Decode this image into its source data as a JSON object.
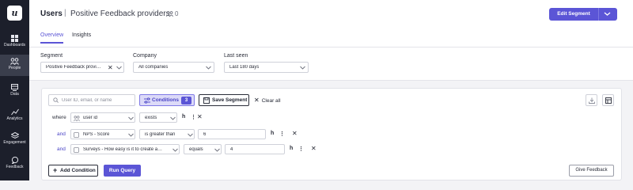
{
  "app": {
    "logo": "u"
  },
  "sidebar": {
    "items": [
      {
        "label": "Dashboards",
        "icon": "grid-icon"
      },
      {
        "label": "People",
        "icon": "people-icon",
        "active": true
      },
      {
        "label": "Data",
        "icon": "database-icon"
      },
      {
        "label": "Analytics",
        "icon": "chart-line-icon"
      },
      {
        "label": "Engagement",
        "icon": "layers-icon"
      },
      {
        "label": "Feedback",
        "icon": "chat-bubble-icon"
      }
    ]
  },
  "header": {
    "title": "Users",
    "separator": "|",
    "subtitle": "Positive Feedback providers",
    "user_count": "0",
    "edit_segment_label": "Edit Segment",
    "tabs": [
      {
        "label": "Overview",
        "active": true
      },
      {
        "label": "Insights",
        "active": false
      }
    ]
  },
  "filters": {
    "segment": {
      "label": "Segment",
      "value": "Positive Feedback provi…"
    },
    "company": {
      "label": "Company",
      "value": "All companies"
    },
    "last_seen": {
      "label": "Last seen",
      "value": "Last 180 days"
    }
  },
  "query": {
    "search_placeholder": "User ID, email, or name",
    "conditions_label": "Conditions",
    "conditions_count": "3",
    "save_segment_label": "Save Segment",
    "clear_all_label": "Clear all",
    "rows": [
      {
        "connector": "where",
        "attribute": "user id",
        "operator": "exists",
        "value": ""
      },
      {
        "connector": "and",
        "attribute": "NPS  - Score",
        "operator": "is greater than",
        "value": "6"
      },
      {
        "connector": "and",
        "attribute": "Surveys  - How easy is it to create a…",
        "operator": "equals",
        "value": "4"
      }
    ],
    "add_condition_label": "Add Condition",
    "run_query_label": "Run Query",
    "give_feedback_label": "Give Feedback"
  },
  "colors": {
    "accent": "#5b55d6",
    "sidebar": "#1c1f2b",
    "accent_light": "#dcdaf8"
  }
}
